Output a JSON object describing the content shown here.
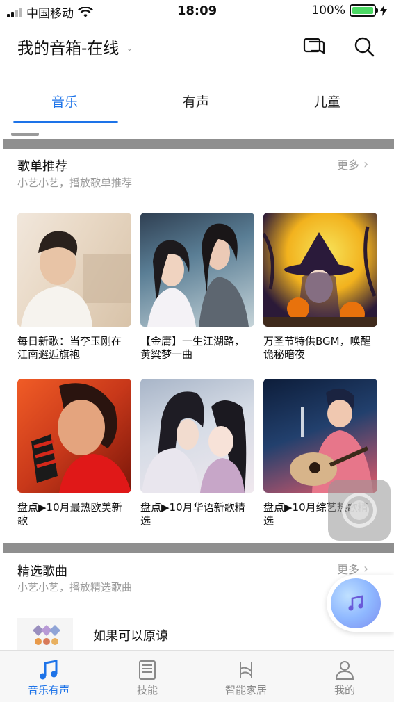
{
  "status_bar": {
    "carrier": "中国移动",
    "time": "18:09",
    "battery_percent": "100%",
    "battery_level": 1.0
  },
  "header": {
    "title": "我的音箱-在线"
  },
  "tabs": [
    {
      "label": "音乐",
      "active": true
    },
    {
      "label": "有声",
      "active": false
    },
    {
      "label": "儿童",
      "active": false
    }
  ],
  "playlist_section": {
    "title": "歌单推荐",
    "subtitle": "小艺小艺，播放歌单推荐",
    "more_label": "更多",
    "items": [
      {
        "title": "每日新歌：当李玉刚在江南邂逅旗袍"
      },
      {
        "title": "【金庸】一生江湖路，黄粱梦一曲"
      },
      {
        "title": "万圣节特供BGM，唤醒诡秘暗夜"
      },
      {
        "title": "盘点▶10月最热欧美新歌"
      },
      {
        "title": "盘点▶10月华语新歌精选"
      },
      {
        "title": "盘点▶10月综艺热歌精选"
      }
    ]
  },
  "songs_section": {
    "title": "精选歌曲",
    "subtitle": "小艺小艺，播放精选歌曲",
    "more_label": "更多",
    "first_song": "如果可以原谅"
  },
  "bottom_nav": [
    {
      "label": "音乐有声",
      "icon": "music-note-icon",
      "active": true
    },
    {
      "label": "技能",
      "icon": "book-icon",
      "active": false
    },
    {
      "label": "智能家居",
      "icon": "home-device-icon",
      "active": false
    },
    {
      "label": "我的",
      "icon": "person-icon",
      "active": false
    }
  ],
  "colors": {
    "accent": "#1d73e8",
    "secondary_text": "#9a9a9a",
    "battery": "#4cd964"
  }
}
